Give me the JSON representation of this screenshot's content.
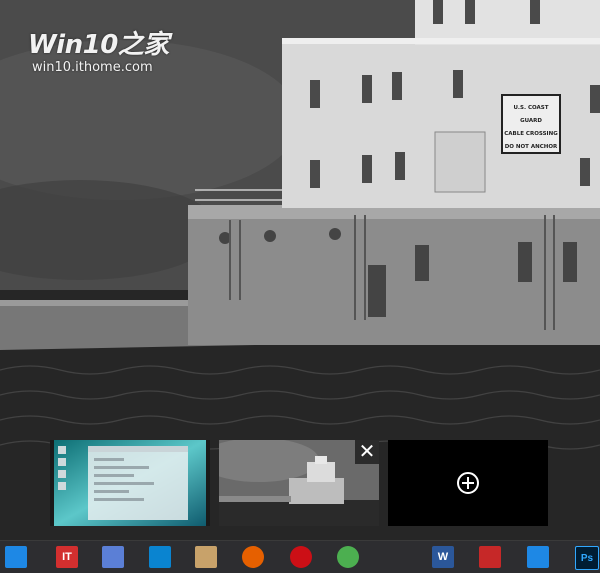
{
  "watermark": {
    "title": "Win10之家",
    "url": "win10.ithome.com"
  },
  "wallpaper": {
    "sign_line1": "U.S. COAST GUARD",
    "sign_line2": "CABLE CROSSING",
    "sign_line3": "DO NOT ANCHOR"
  },
  "task_view": {
    "close_symbol": "✕",
    "new_desktop_icon": "plus-circle-icon"
  },
  "taskbar": {
    "icons": [
      {
        "name": "task-view-icon",
        "label": "",
        "color": "#1e88e5"
      },
      {
        "name": "ithome-icon",
        "label": "IT",
        "color": "#d32f2f"
      },
      {
        "name": "file-manager-icon",
        "label": "",
        "color": "#5b7fd6"
      },
      {
        "name": "remote-app-icon",
        "label": "",
        "color": "#0a84d0"
      },
      {
        "name": "paint-palette-icon",
        "label": "",
        "color": "#c8a26a"
      },
      {
        "name": "firefox-icon",
        "label": "",
        "color": "#e66000"
      },
      {
        "name": "opera-icon",
        "label": "",
        "color": "#cc0f16"
      },
      {
        "name": "chrome-icon",
        "label": "",
        "color": "#4caf50"
      },
      {
        "name": "qq-icon",
        "label": "",
        "color": "#222222"
      },
      {
        "name": "word-icon",
        "label": "W",
        "color": "#2b579a"
      },
      {
        "name": "app-red-icon",
        "label": "",
        "color": "#c62828"
      },
      {
        "name": "bird-app-icon",
        "label": "",
        "color": "#1e88e5"
      },
      {
        "name": "photoshop-icon",
        "label": "Ps",
        "color": "#001d34"
      }
    ]
  }
}
